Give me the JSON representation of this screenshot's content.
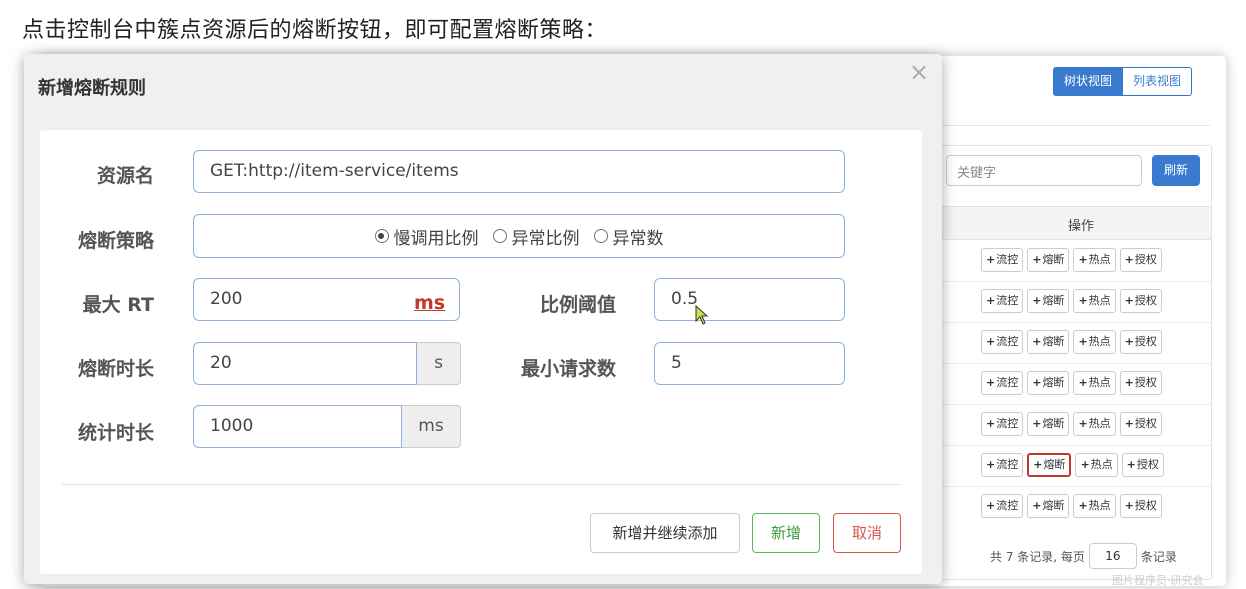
{
  "caption": "点击控制台中簇点资源后的熔断按钮，即可配置熔断策略：",
  "console": {
    "view_tree": "树状视图",
    "view_list": "列表视图",
    "keyword_placeholder": "关键字",
    "refresh": "刷新",
    "col_ops": "操作",
    "row_buttons": [
      "流控",
      "熔断",
      "热点",
      "授权"
    ],
    "row_count": 7,
    "highlight_row": 6,
    "pager": {
      "prefix": "共 7 条记录, 每页",
      "per_page": "16",
      "suffix": "条记录"
    },
    "watermark": "图片程序员·研究会"
  },
  "modal": {
    "title": "新增熔断规则",
    "close": "×",
    "fields": {
      "resource_label": "资源名",
      "resource_value": "GET:http://item-service/items",
      "strategy_label": "熔断策略",
      "strategy_options": [
        "慢调用比例",
        "异常比例",
        "异常数"
      ],
      "strategy_selected": 0,
      "max_rt_label": "最大 RT",
      "max_rt_value": "200",
      "max_rt_unit": "ms",
      "ratio_label": "比例阈值",
      "ratio_value": "0.5",
      "duration_label": "熔断时长",
      "duration_value": "20",
      "duration_unit": "s",
      "min_req_label": "最小请求数",
      "min_req_value": "5",
      "stat_label": "统计时长",
      "stat_value": "1000",
      "stat_unit": "ms"
    },
    "buttons": {
      "add_continue": "新增并继续添加",
      "add": "新增",
      "cancel": "取消"
    }
  }
}
